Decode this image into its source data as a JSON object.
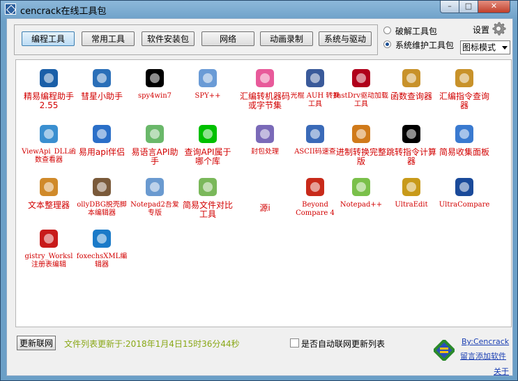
{
  "window": {
    "title": "cencrack在线工具包",
    "close_label": "✕",
    "min_label": "–",
    "max_label": "□"
  },
  "tabs": [
    {
      "label": "编程工具",
      "active": true
    },
    {
      "label": "常用工具"
    },
    {
      "label": "软件安装包"
    },
    {
      "label": "网络"
    },
    {
      "label": "动画录制"
    },
    {
      "label": "系统与驱动"
    }
  ],
  "radios": [
    {
      "label": "破解工具包",
      "checked": false
    },
    {
      "label": "系统维护工具包",
      "checked": true
    }
  ],
  "settings_label": "设置",
  "view_mode": "图标模式",
  "tools": [
    {
      "name": "精易编程助手2.55",
      "icon": "easy-programming-icon",
      "color": "#1a5fa8"
    },
    {
      "name": "彗星小助手",
      "icon": "comet-helper-icon",
      "color": "#2a6fb8"
    },
    {
      "name": "spy4win7",
      "icon": "spy-face-icon",
      "color": "#000000"
    },
    {
      "name": "SPY++",
      "icon": "magnifier-icon",
      "color": "#6a9bd6"
    },
    {
      "name": "汇编转机器码或字节集",
      "icon": "pink-blob-icon",
      "color": "#e85a9a"
    },
    {
      "name": "光棍 AUH 转换工具",
      "icon": "gear-tool-icon",
      "color": "#3a5a9a"
    },
    {
      "name": "InstDrv驱动加载工具",
      "icon": "sys-icon",
      "color": "#b0001a"
    },
    {
      "name": "函数查询器",
      "icon": "search-glass-icon",
      "color": "#c8922a"
    },
    {
      "name": "汇编指令查询器",
      "icon": "search-glass-icon",
      "color": "#c8922a"
    },
    {
      "name": "ViewApi_DLL函数查看器",
      "icon": "viewapi-icon",
      "color": "#3a8fd0"
    },
    {
      "name": "易用api伴侣",
      "icon": "api-companion-icon",
      "color": "#2a6fc8"
    },
    {
      "name": "易语言API助手",
      "icon": "api-helper-icon",
      "color": "#6ab86a"
    },
    {
      "name": "查询API属于哪个库",
      "icon": "api-green-icon",
      "color": "#00c000"
    },
    {
      "name": "封包处理",
      "icon": "packet-icon",
      "color": "#7a6ab8"
    },
    {
      "name": "ASCII码速查",
      "icon": "ascii-icon",
      "color": "#3a6ab8"
    },
    {
      "name": "进制转换完整版",
      "icon": "base-convert-icon",
      "color": "#d07a1a"
    },
    {
      "name": "跳转指令计算器",
      "icon": "jtick-icon",
      "color": "#000000"
    },
    {
      "name": "简易收集面板",
      "icon": "notepad-pen-icon",
      "color": "#3a7ad0"
    },
    {
      "name": "文本整理器",
      "icon": "text-tool-icon",
      "color": "#d08a2a"
    },
    {
      "name": "ollyDBG脱壳脚本编辑器",
      "icon": "olly-icon",
      "color": "#7a5a3a"
    },
    {
      "name": "Notepad2吾爱专版",
      "icon": "notepad2-icon",
      "color": "#6a9ad0"
    },
    {
      "name": "简易文件对比工具",
      "icon": "file-compare-icon",
      "color": "#7ab85a"
    },
    {
      "name": "源i",
      "icon": "",
      "color": ""
    },
    {
      "name": "Beyond Compare 4",
      "icon": "beyond-compare-icon",
      "color": "#c82a1a"
    },
    {
      "name": "Notepad++",
      "icon": "notepadpp-icon",
      "color": "#7ac04a"
    },
    {
      "name": "UltraEdit",
      "icon": "ultraedit-icon",
      "color": "#c89a1a"
    },
    {
      "name": "UltraCompare",
      "icon": "ultracompare-icon",
      "color": "#1a4a9a"
    },
    {
      "name": "gistry_Worksl注册表编辑",
      "icon": "registry-cubes-icon",
      "color": "#c81a1a"
    },
    {
      "name": "foxechsXML编辑器",
      "icon": "foxechs-icon",
      "color": "#1a7ac8"
    }
  ],
  "footer": {
    "refresh_label": "更新联网",
    "update_text": "文件列表更新于:2018年1月4日15时36分44秒",
    "auto_update_label": "是否自动联网更新列表",
    "author_link": "By:Cencrack",
    "add_software_link": "留言添加软件",
    "about_link": "关于"
  }
}
